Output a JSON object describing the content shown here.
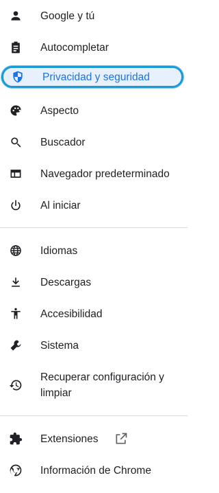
{
  "menu": {
    "items": [
      {
        "label": "Google y tú",
        "icon": "person-icon"
      },
      {
        "label": "Autocompletar",
        "icon": "clipboard-icon"
      },
      {
        "label": "Privacidad y seguridad",
        "icon": "shield-icon",
        "active": true
      },
      {
        "label": "Aspecto",
        "icon": "palette-icon"
      },
      {
        "label": "Buscador",
        "icon": "search-icon"
      },
      {
        "label": "Navegador predeterminado",
        "icon": "browser-window-icon"
      },
      {
        "label": "Al iniciar",
        "icon": "power-icon"
      },
      {
        "label": "Idiomas",
        "icon": "globe-icon"
      },
      {
        "label": "Descargas",
        "icon": "download-icon"
      },
      {
        "label": "Accesibilidad",
        "icon": "accessibility-icon"
      },
      {
        "label": "Sistema",
        "icon": "wrench-icon"
      },
      {
        "label": "Recuperar configuración y limpiar",
        "icon": "restore-icon"
      },
      {
        "label": "Extensiones",
        "icon": "puzzle-icon",
        "external_icon": "open-in-new-icon"
      },
      {
        "label": "Información de Chrome",
        "icon": "chrome-icon"
      }
    ]
  },
  "colors": {
    "active_text": "#1a73e8",
    "active_background": "#e8f0fe",
    "highlight_outline": "#1a9ad6",
    "text": "#202124",
    "divider": "#dadce0"
  }
}
